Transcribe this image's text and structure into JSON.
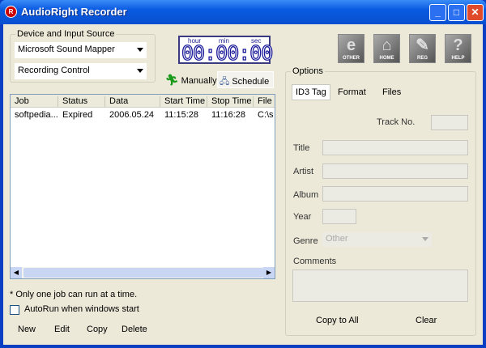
{
  "window": {
    "title": "AudioRight Recorder",
    "logo": "R",
    "minimize": "_",
    "maximize": "□",
    "close": "✕"
  },
  "device": {
    "legend": "Device and Input Source",
    "source": "Microsoft Sound Mapper",
    "control": "Recording Control"
  },
  "timer": {
    "hour_label": "hour",
    "min_label": "min",
    "sec_label": "sec",
    "display": "00:00:00"
  },
  "toolbar_icons": [
    {
      "label": "OTHER",
      "icon": "ie-icon"
    },
    {
      "label": "HOME",
      "icon": "home-icon"
    },
    {
      "label": "REG",
      "icon": "register-icon"
    },
    {
      "label": "HELP",
      "icon": "help-icon"
    }
  ],
  "mode": {
    "manually": "Manually",
    "schedule": "Schedule"
  },
  "jobs": {
    "columns": [
      "Job",
      "Status",
      "Data",
      "Start Time",
      "Stop Time",
      "File"
    ],
    "rows": [
      [
        "softpedia...",
        "Expired",
        "2006.05.24",
        "11:15:28",
        "11:16:28",
        "C:\\s"
      ]
    ]
  },
  "note": "* Only one job can run at a time.",
  "autorun": {
    "label": "AutoRun when windows start",
    "checked": false
  },
  "actions": {
    "new": "New",
    "edit": "Edit",
    "copy": "Copy",
    "delete": "Delete"
  },
  "options": {
    "legend": "Options",
    "tabs": [
      "ID3 Tag",
      "Format",
      "Files"
    ],
    "active_tab": "ID3 Tag",
    "track_label": "Track No.",
    "title_label": "Title",
    "artist_label": "Artist",
    "album_label": "Album",
    "year_label": "Year",
    "genre_label": "Genre",
    "genre_value": "Other",
    "comments_label": "Comments",
    "copy_all": "Copy to All",
    "clear": "Clear"
  }
}
